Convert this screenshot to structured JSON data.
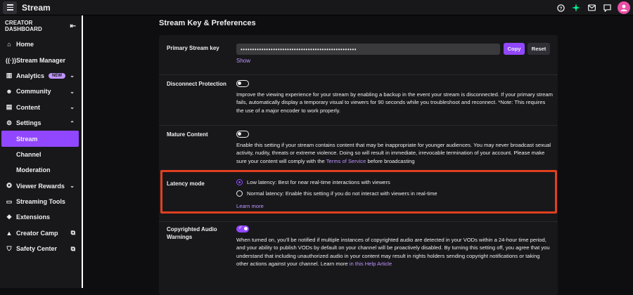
{
  "topbar": {
    "title": "Stream",
    "icons": [
      "help-icon",
      "sparkle-icon",
      "mail-icon",
      "chat-icon",
      "avatar"
    ]
  },
  "sidebar": {
    "header": "CREATOR DASHBOARD",
    "items": [
      {
        "label": "Home",
        "icon": "home-icon"
      },
      {
        "label": "Stream Manager",
        "icon": "broadcast-icon"
      },
      {
        "label": "Analytics",
        "icon": "analytics-icon",
        "badge": "NEW"
      },
      {
        "label": "Community",
        "icon": "community-icon"
      },
      {
        "label": "Content",
        "icon": "content-icon"
      },
      {
        "label": "Settings",
        "icon": "gear-icon"
      },
      {
        "label": "Stream"
      },
      {
        "label": "Channel"
      },
      {
        "label": "Moderation"
      },
      {
        "label": "Viewer Rewards",
        "icon": "rewards-icon"
      },
      {
        "label": "Streaming Tools",
        "icon": "camera-icon"
      },
      {
        "label": "Extensions",
        "icon": "extensions-icon"
      },
      {
        "label": "Creator Camp",
        "icon": "camp-icon"
      },
      {
        "label": "Safety Center",
        "icon": "shield-icon"
      }
    ]
  },
  "main": {
    "section_title": "Stream Key & Preferences",
    "primary_key": {
      "label": "Primary Stream key",
      "value": "••••••••••••••••••••••••••••••••••••••••••••••••••",
      "copy": "Copy",
      "reset": "Reset",
      "show": "Show"
    },
    "disconnect": {
      "label": "Disconnect Protection",
      "description": "Improve the viewing experience for your stream by enabling a backup in the event your stream is disconnected. If your primary stream fails, automatically display a temporary visual to viewers for 90 seconds while you troubleshoot and reconnect. *Note: This requires the use of a major encoder to work properly.",
      "enabled": false
    },
    "mature": {
      "label": "Mature Content",
      "description_pre": "Enable this setting if your stream contains content that may be inappropriate for younger audiences. You may never broadcast sexual activity, nudity, threats or extreme violence. Doing so will result in immediate, irrevocable termination of your account. Please make sure your content will comply with the",
      "tos_link": "Terms of Service",
      "description_post": "before broadcasting",
      "enabled": false
    },
    "latency": {
      "label": "Latency mode",
      "options": [
        {
          "label": "Low latency: Best for near real-time interactions with viewers",
          "checked": true
        },
        {
          "label": "Normal latency: Enable this setting if you do not interact with viewers in real-time",
          "checked": false
        }
      ],
      "learn_more": "Learn more"
    },
    "copyright": {
      "label": "Copyrighted Audio Warnings",
      "description_pre": "When turned on, you'll be notified if multiple instances of copyrighted audio are detected in your VODs within a 24-hour time period, and your ability to publish VODs by default on your channel will be proactively disabled. By turning this setting off, you agree that you understand that including unauthorized audio in your content may result in rights holders sending copyright notifications or taking other actions against your channel. Learn more",
      "help_link": "in this Help Article",
      "enabled": true
    }
  },
  "colors": {
    "accent": "#9147ff",
    "highlight": "#e0401f",
    "link": "#bf94ff"
  }
}
